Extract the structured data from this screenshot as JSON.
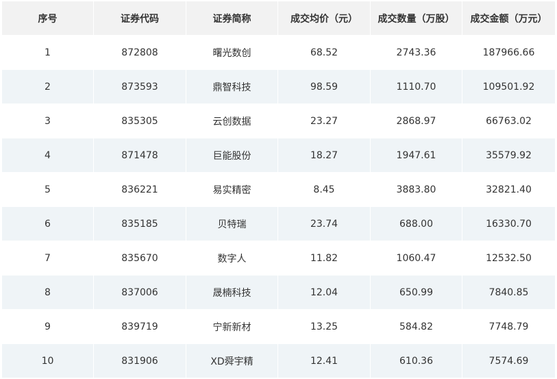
{
  "table": {
    "headers": [
      "序号",
      "证券代码",
      "证券简称",
      "成交均价（元）",
      "成交数量（万股）",
      "成交金额（万元）"
    ],
    "rows": [
      [
        "1",
        "872808",
        "曙光数创",
        "68.52",
        "2743.36",
        "187966.66"
      ],
      [
        "2",
        "873593",
        "鼎智科技",
        "98.59",
        "1110.70",
        "109501.92"
      ],
      [
        "3",
        "835305",
        "云创数据",
        "23.27",
        "2868.97",
        "66763.02"
      ],
      [
        "4",
        "871478",
        "巨能股份",
        "18.27",
        "1947.61",
        "35579.92"
      ],
      [
        "5",
        "836221",
        "易实精密",
        "8.45",
        "3883.80",
        "32821.40"
      ],
      [
        "6",
        "835185",
        "贝特瑞",
        "23.74",
        "688.00",
        "16330.70"
      ],
      [
        "7",
        "835670",
        "数字人",
        "11.82",
        "1060.47",
        "12532.50"
      ],
      [
        "8",
        "837006",
        "晟楠科技",
        "12.04",
        "650.99",
        "7840.85"
      ],
      [
        "9",
        "839719",
        "宁新新材",
        "13.25",
        "584.82",
        "7748.79"
      ],
      [
        "10",
        "831906",
        "XD舜宇精",
        "12.41",
        "610.36",
        "7574.69"
      ]
    ]
  },
  "colors": {
    "header_bg": "#f2f2f2",
    "row_odd_bg": "#ffffff",
    "row_even_bg": "#eff4f7",
    "text": "#333333"
  }
}
